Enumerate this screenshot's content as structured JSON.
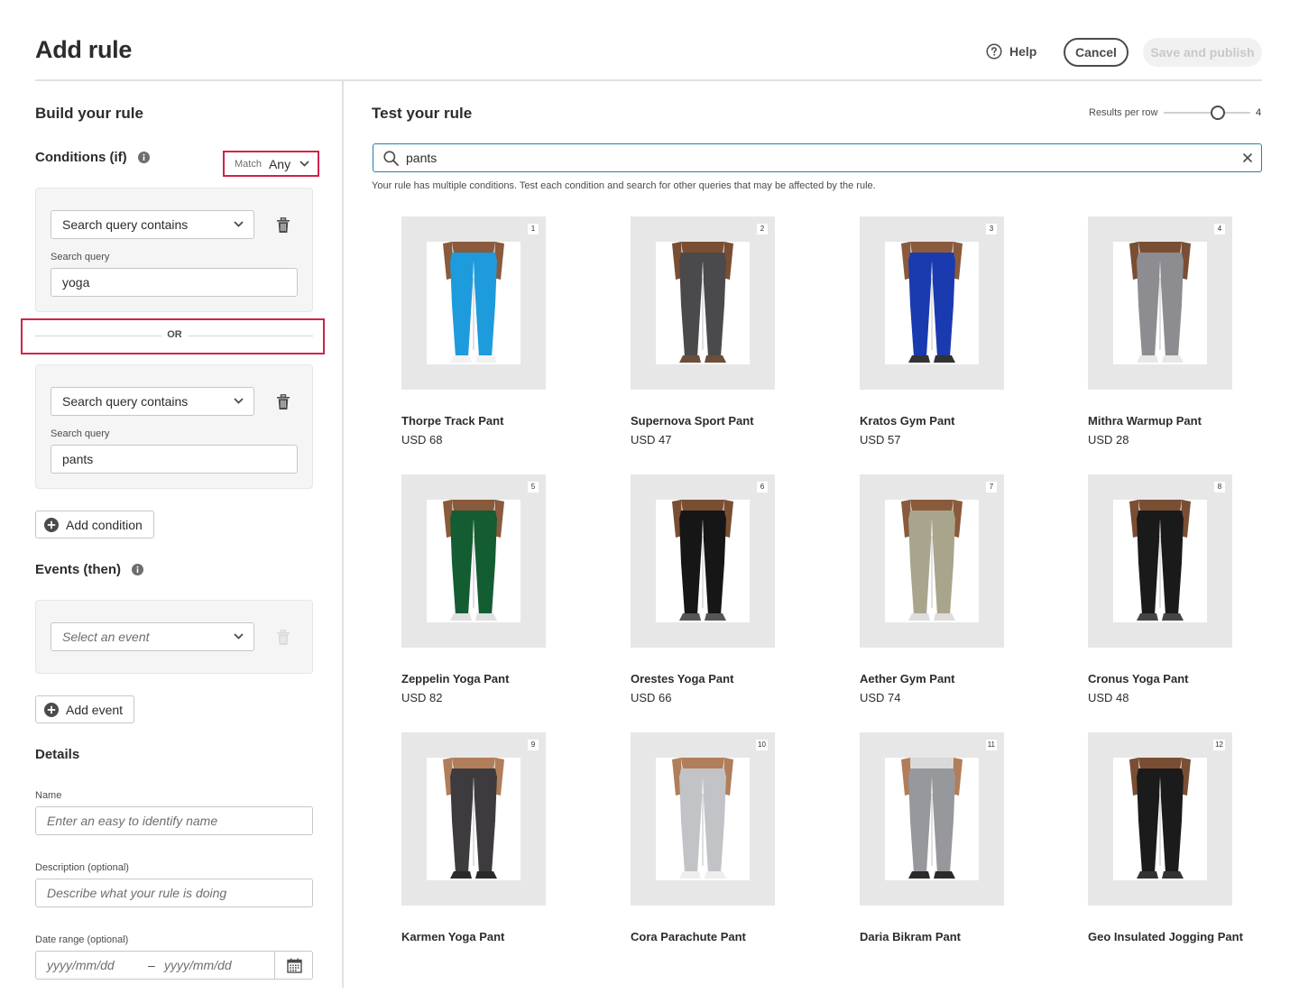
{
  "header": {
    "title": "Add rule",
    "help_label": "Help",
    "cancel_label": "Cancel",
    "save_label": "Save and publish"
  },
  "build": {
    "title": "Build your rule",
    "conditions_title": "Conditions (if)",
    "match_label": "Match",
    "match_value": "Any",
    "conditions": [
      {
        "type": "Search query contains",
        "field_label": "Search query",
        "value": "yoga"
      },
      {
        "type": "Search query contains",
        "field_label": "Search query",
        "value": "pants"
      }
    ],
    "or_label": "OR",
    "add_condition_label": "Add condition",
    "events_title": "Events (then)",
    "event_placeholder": "Select an event",
    "add_event_label": "Add event"
  },
  "details": {
    "title": "Details",
    "name_label": "Name",
    "name_placeholder": "Enter an easy to identify name",
    "description_label": "Description (optional)",
    "description_placeholder": "Describe what your rule is doing",
    "date_label": "Date range (optional)",
    "date_from_placeholder": "yyyy/mm/dd",
    "date_separator": "–",
    "date_to_placeholder": "yyyy/mm/dd"
  },
  "test": {
    "title": "Test your rule",
    "results_per_row_label": "Results per row",
    "results_per_row_value": "4",
    "search_value": "pants",
    "hint": "Your rule has multiple conditions. Test each condition and search for other queries that may be affected by the rule.",
    "products": [
      {
        "rank": "1",
        "name": "Thorpe Track Pant",
        "price": "USD 68",
        "color": "#1e9bdc",
        "skin": "#8a5a3c",
        "top": "#8a5a3c",
        "shoe": "#f2f2f2"
      },
      {
        "rank": "2",
        "name": "Supernova Sport Pant",
        "price": "USD 47",
        "color": "#4a4a4c",
        "skin": "#7a4e33",
        "top": "#7a4e33",
        "shoe": "#6b4f3a"
      },
      {
        "rank": "3",
        "name": "Kratos Gym Pant",
        "price": "USD 57",
        "color": "#1a3ab0",
        "skin": "#8a5a3c",
        "top": "#8a5a3c",
        "shoe": "#333333"
      },
      {
        "rank": "4",
        "name": "Mithra Warmup Pant",
        "price": "USD 28",
        "color": "#8d8d91",
        "skin": "#7a4e33",
        "top": "#7a4e33",
        "shoe": "#e8e8e8"
      },
      {
        "rank": "5",
        "name": "Zeppelin Yoga Pant",
        "price": "USD 82",
        "color": "#145c32",
        "skin": "#8a5a3c",
        "top": "#8a5a3c",
        "shoe": "#e0e0e0"
      },
      {
        "rank": "6",
        "name": "Orestes Yoga Pant",
        "price": "USD 66",
        "color": "#161616",
        "skin": "#7a4e33",
        "top": "#7a4e33",
        "shoe": "#555555"
      },
      {
        "rank": "7",
        "name": "Aether Gym Pant",
        "price": "USD 74",
        "color": "#a9a58c",
        "skin": "#8a5a3c",
        "top": "#8a5a3c",
        "shoe": "#dddddd"
      },
      {
        "rank": "8",
        "name": "Cronus Yoga Pant",
        "price": "USD 48",
        "color": "#1a1a1a",
        "skin": "#7a4e33",
        "top": "#7a4e33",
        "shoe": "#444444"
      },
      {
        "rank": "9",
        "name": "Karmen Yoga Pant",
        "price": "",
        "color": "#3d3b3d",
        "skin": "#b07e5a",
        "top": "#b07e5a",
        "shoe": "#2a2a2a"
      },
      {
        "rank": "10",
        "name": "Cora Parachute Pant",
        "price": "",
        "color": "#c2c3c7",
        "skin": "#b07e5a",
        "top": "#b07e5a",
        "shoe": "#eeeeee"
      },
      {
        "rank": "11",
        "name": "Daria Bikram Pant",
        "price": "",
        "color": "#97989b",
        "skin": "#b07e5a",
        "top": "#d9d9d9",
        "shoe": "#2a2a2a"
      },
      {
        "rank": "12",
        "name": "Geo Insulated Jogging Pant",
        "price": "",
        "color": "#1b1b1b",
        "skin": "#7a4e33",
        "top": "#7a4e33",
        "shoe": "#333333"
      }
    ]
  },
  "colors": {
    "highlight": "#d0234b",
    "search_border": "#2680a8"
  }
}
